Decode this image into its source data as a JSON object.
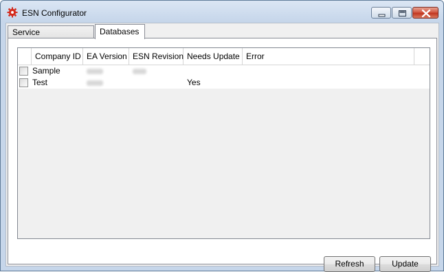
{
  "window": {
    "title": "ESN Configurator"
  },
  "tabs": [
    {
      "label": "Service Configuration",
      "selected": false
    },
    {
      "label": "Databases",
      "selected": true
    }
  ],
  "grid": {
    "columns": [
      "Company ID",
      "EA Version",
      "ESN Revision",
      "Needs Update",
      "Error"
    ],
    "rows": [
      {
        "checked": false,
        "company_id": "Sample",
        "ea_version": "",
        "esn_revision": "",
        "needs_update": "",
        "error": ""
      },
      {
        "checked": false,
        "company_id": "Test",
        "ea_version": "",
        "esn_revision": "",
        "needs_update": "Yes",
        "error": ""
      }
    ]
  },
  "buttons": {
    "refresh": "Refresh",
    "update": "Update"
  },
  "icons": {
    "app": "gear-icon",
    "minimize": "minimize-icon",
    "maximize": "maximize-icon",
    "close": "close-icon"
  },
  "colors": {
    "title_bar": "#c6d6ea",
    "close_button": "#c1351f",
    "app_icon": "#d42a1c"
  }
}
